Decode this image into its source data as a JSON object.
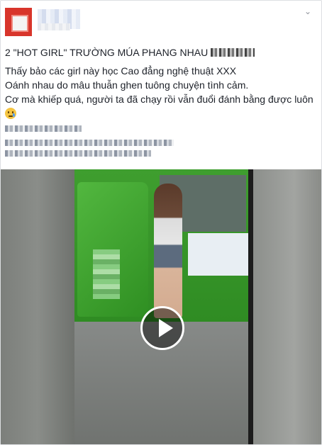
{
  "post": {
    "author_name": "",
    "timestamp": "",
    "menu_icon": "chevron-down-icon",
    "headline": "2 \"HOT GIRL\" TRƯỜNG MÚA PHANG NHAU",
    "body_lines": [
      "Thấy bảo các girl này học Cao đẳng nghệ thuật XXX",
      "Oánh nhau do mâu thuẫn ghen tuông chuyện tình cảm.",
      "Cơ mà khiếp quá, người ta đã chạy rồi vẫn đuổi đánh bằng được luôn"
    ],
    "emoji_icon": "crying-face-icon"
  },
  "video": {
    "play_icon": "play-icon"
  },
  "colors": {
    "avatar": "#d8352b",
    "taxi_green": "#2f8c23",
    "text": "#1d2129"
  }
}
